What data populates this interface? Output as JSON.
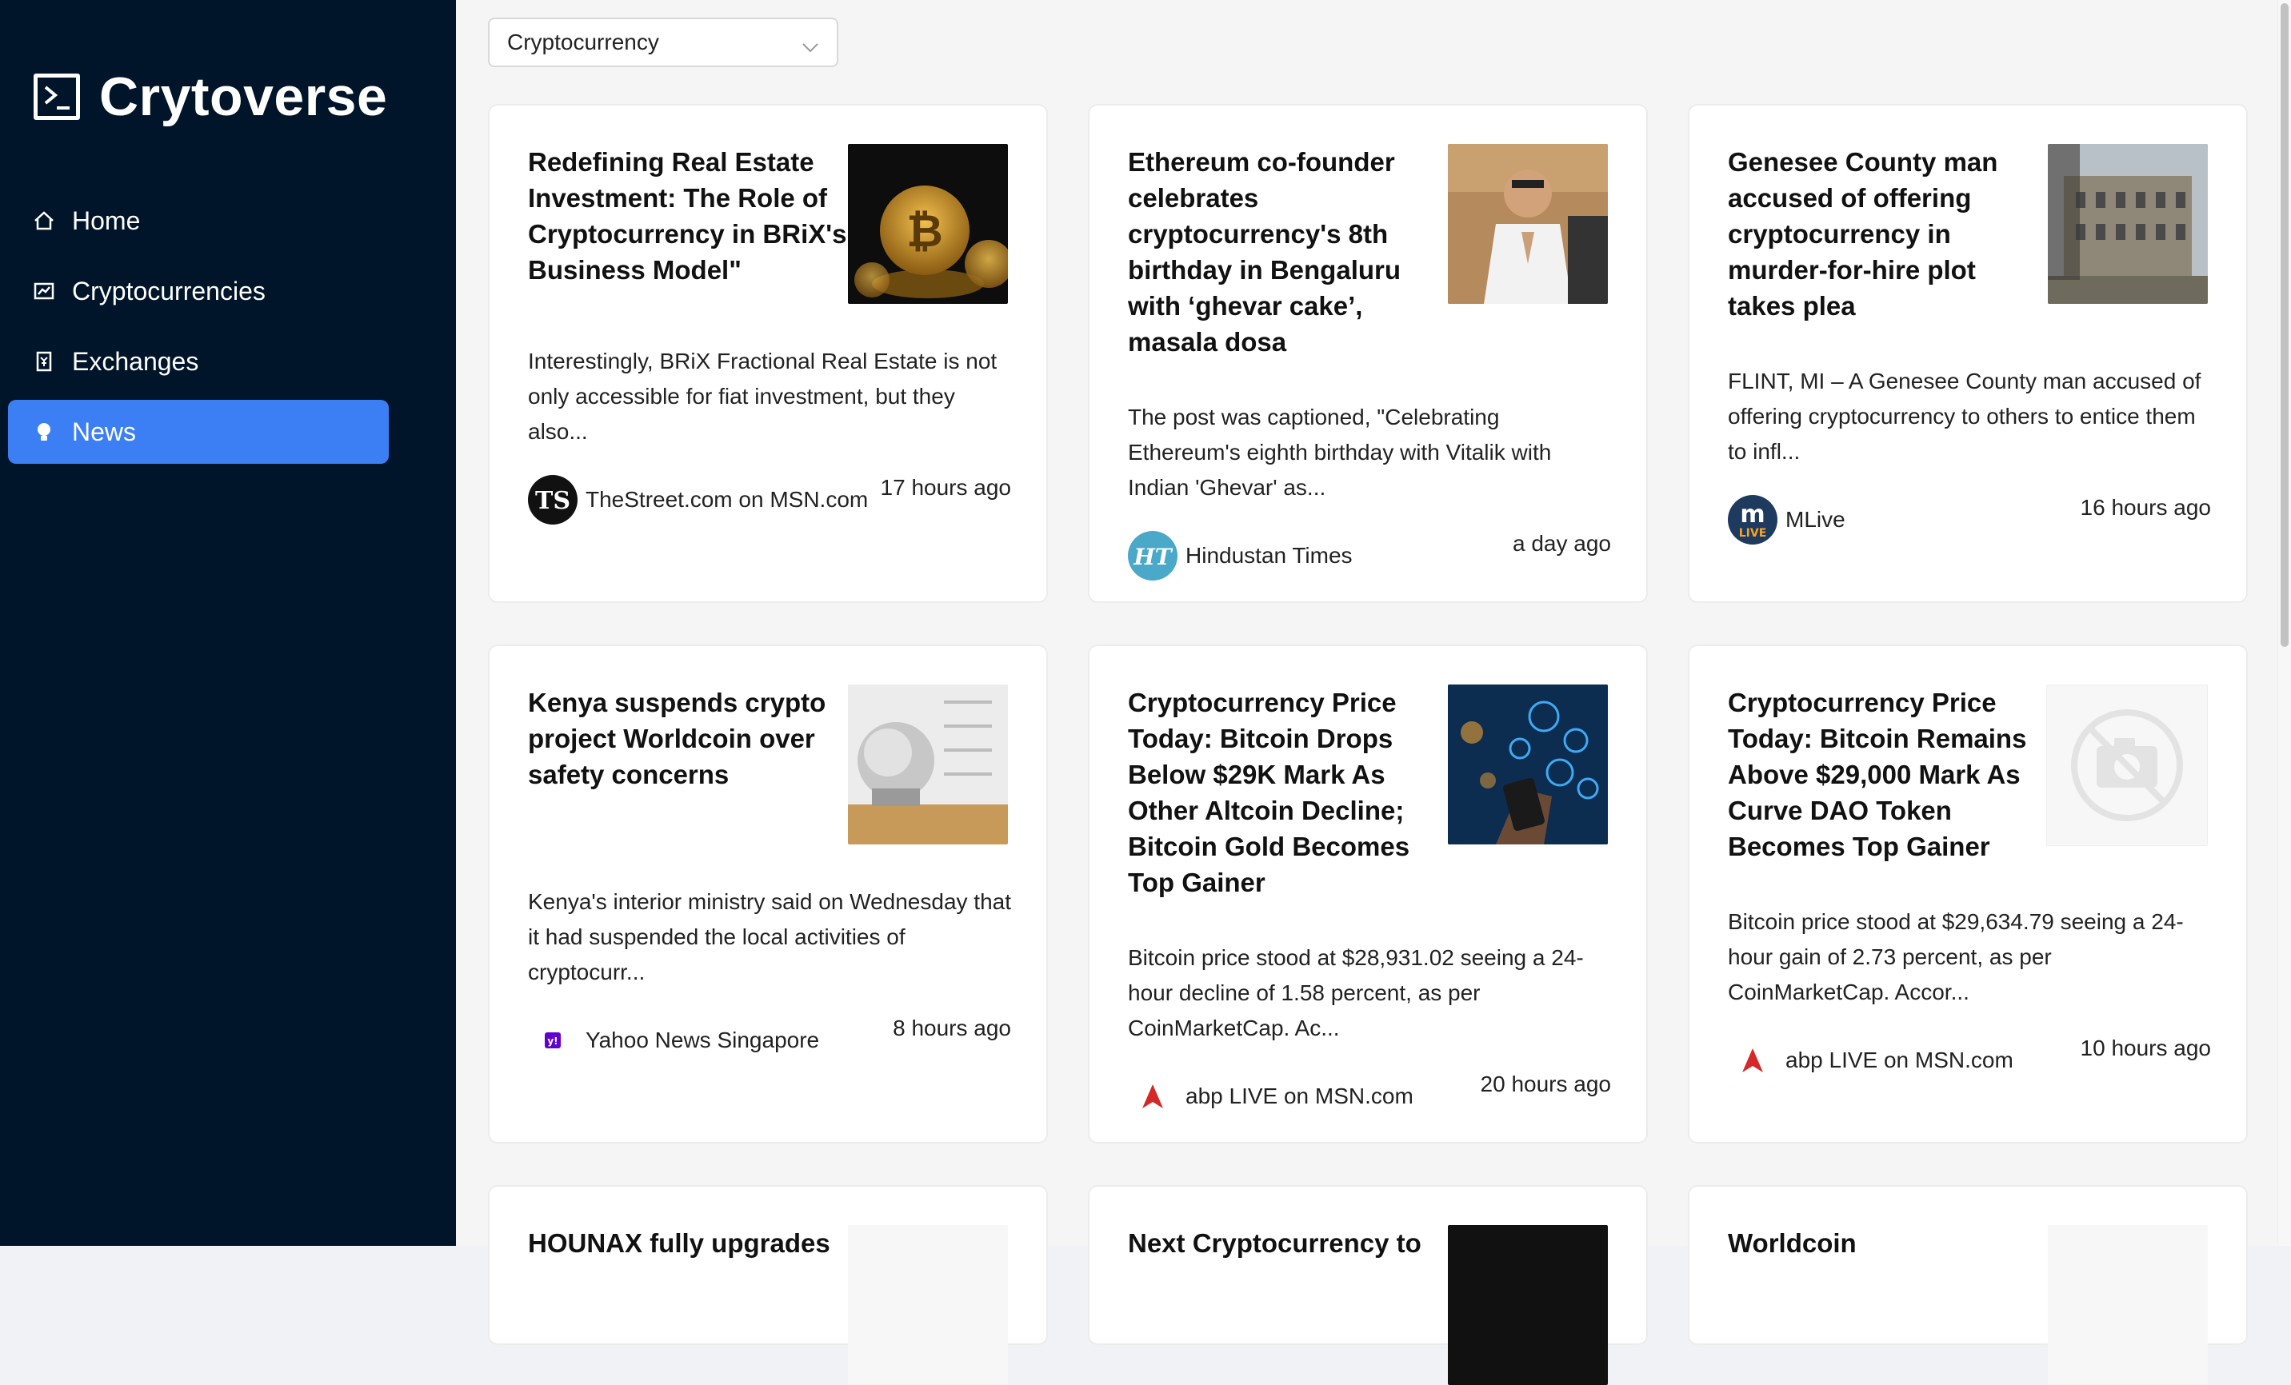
{
  "app": {
    "name": "Crytoverse"
  },
  "sidebar": {
    "items": [
      {
        "label": "Home",
        "icon": "home-icon",
        "active": false
      },
      {
        "label": "Cryptocurrencies",
        "icon": "fund-icon",
        "active": false
      },
      {
        "label": "Exchanges",
        "icon": "money-collect-icon",
        "active": false
      },
      {
        "label": "News",
        "icon": "bulb-icon",
        "active": true
      }
    ]
  },
  "filter": {
    "selected": "Cryptocurrency"
  },
  "colors": {
    "sidebar_bg": "#001529",
    "active_item": "#3c7ef3",
    "page_bg": "#f5f5f5"
  },
  "news": [
    {
      "title": "Redefining Real Estate Investment: The Role of Cryptocurrency in BRiX's Business Model\"",
      "description": "Interestingly, BRiX Fractional Real Estate is not only accessible for fiat investment, but they also...",
      "provider": "TheStreet.com on MSN.com",
      "time": "17 hours ago",
      "image": "bitcoin-coins-image",
      "provider_icon": "thestreet-logo"
    },
    {
      "title": "Ethereum co-founder celebrates cryptocurrency's 8th birthday in Bengaluru with ‘ghevar cake’, masala dosa",
      "description": "The post was captioned, \"Celebrating Ethereum's eighth birthday with Vitalik with Indian 'Ghevar' as...",
      "provider": "Hindustan Times",
      "time": "a day ago",
      "image": "vitalik-photo-image",
      "provider_icon": "hindustan-times-logo"
    },
    {
      "title": "Genesee County man accused of offering cryptocurrency in murder-for-hire plot takes plea",
      "description": "FLINT, MI – A Genesee County man accused of offering cryptocurrency to others to entice them to infl...",
      "provider": "MLive",
      "time": "16 hours ago",
      "image": "courthouse-image",
      "provider_icon": "mlive-logo"
    },
    {
      "title": "Kenya suspends crypto project Worldcoin over safety concerns",
      "description": "Kenya's interior ministry said on Wednesday that it had suspended the local activities of cryptocurr...",
      "provider": "Yahoo News Singapore",
      "time": "8 hours ago",
      "image": "worldcoin-orb-image",
      "provider_icon": "yahoo-logo"
    },
    {
      "title": "Cryptocurrency Price Today: Bitcoin Drops Below $29K Mark As Other Altcoin Decline; Bitcoin Gold Becomes Top Gainer",
      "description": "Bitcoin price stood at $28,931.02 seeing a 24-hour decline of 1.58 percent, as per CoinMarketCap. Ac...",
      "provider": "abp LIVE on MSN.com",
      "time": "20 hours ago",
      "image": "crypto-phone-image",
      "provider_icon": "abp-logo"
    },
    {
      "title": "Cryptocurrency Price Today: Bitcoin Remains Above $29,000 Mark As Curve DAO Token Becomes Top Gainer",
      "description": "Bitcoin price stood at $29,634.79 seeing a 24-hour gain of 2.73 percent, as per CoinMarketCap. Accor...",
      "provider": "abp LIVE on MSN.com",
      "time": "10 hours ago",
      "image": "placeholder-camera-image",
      "provider_icon": "abp-logo"
    },
    {
      "title": "HOUNAX fully upgrades",
      "image": "blank-image"
    },
    {
      "title": "Next Cryptocurrency to",
      "image": "dark-image"
    },
    {
      "title": "Worldcoin",
      "image": "blank-image"
    }
  ]
}
